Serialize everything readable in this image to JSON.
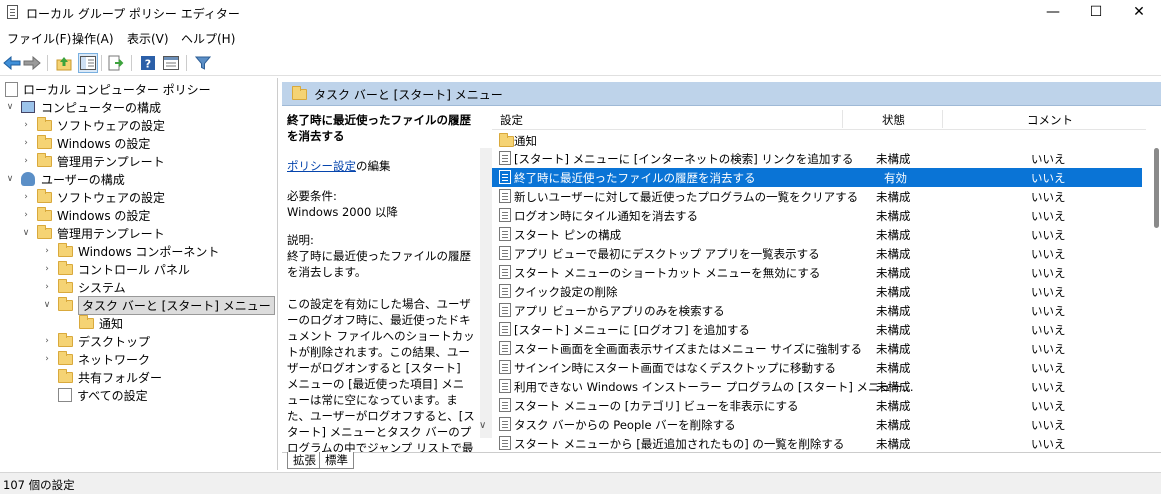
{
  "window": {
    "title": "ローカル グループ ポリシー エディター",
    "controls": {
      "minimize": "—",
      "maximize": "☐",
      "close": "✕"
    }
  },
  "menu": [
    "ファイル(F)",
    "操作(A)",
    "表示(V)",
    "ヘルプ(H)"
  ],
  "toolbar": [
    "back-icon",
    "forward-icon",
    "up-folder-icon",
    "show-tree-icon",
    "export-list-icon",
    "help-icon",
    "properties-icon",
    "filter-icon"
  ],
  "tree": [
    {
      "label": "ローカル コンピューター ポリシー"
    },
    {
      "label": "コンピューターの構成"
    },
    {
      "label": "ソフトウェアの設定"
    },
    {
      "label": "Windows の設定"
    },
    {
      "label": "管理用テンプレート"
    },
    {
      "label": "ユーザーの構成"
    },
    {
      "label": "ソフトウェアの設定"
    },
    {
      "label": "Windows の設定"
    },
    {
      "label": "管理用テンプレート"
    },
    {
      "label": "Windows コンポーネント"
    },
    {
      "label": "コントロール パネル"
    },
    {
      "label": "システム"
    },
    {
      "label": "タスク バーと [スタート] メニュー"
    },
    {
      "label": "通知"
    },
    {
      "label": "デスクトップ"
    },
    {
      "label": "ネットワーク"
    },
    {
      "label": "共有フォルダー"
    },
    {
      "label": "すべての設定"
    }
  ],
  "right_header": {
    "title": "タスク バーと [スタート] メニュー"
  },
  "description": {
    "title": "終了時に最近使ったファイルの履歴を消去する",
    "edit_link": "ポリシー設定",
    "edit_suffix": "の編集",
    "requirement_label": "必要条件:",
    "requirement_value": "Windows 2000 以降",
    "explain_label": "説明:",
    "explain_value": "終了時に最近使ったファイルの履歴を消去します。",
    "detail": "この設定を有効にした場合、ユーザーのログオフ時に、最近使ったドキュメント ファイルへのショートカットが削除されます。この結果、ユーザーがログオンすると [スタート] メニューの [最近使った項目] メニューは常に空になっています。また、ユーザーがログオフすると、[スタート] メニューとタスク バーのプログラムの中でジャンプ リストで最近使った項目や頻繁に使った項目も消去されます。"
  },
  "list": {
    "headers": {
      "setting": "設定",
      "state": "状態",
      "comment": "コメント"
    },
    "folder": "通知",
    "rows": [
      {
        "name": "[スタート] メニューに [インターネットの検索] リンクを追加する",
        "state": "未構成",
        "comment": "いいえ"
      },
      {
        "name": "終了時に最近使ったファイルの履歴を消去する",
        "state": "有効",
        "comment": "いいえ"
      },
      {
        "name": "新しいユーザーに対して最近使ったプログラムの一覧をクリアする",
        "state": "未構成",
        "comment": "いいえ"
      },
      {
        "name": "ログオン時にタイル通知を消去する",
        "state": "未構成",
        "comment": "いいえ"
      },
      {
        "name": "スタート ピンの構成",
        "state": "未構成",
        "comment": "いいえ"
      },
      {
        "name": "アプリ ビューで最初にデスクトップ アプリを一覧表示する",
        "state": "未構成",
        "comment": "いいえ"
      },
      {
        "name": "スタート メニューのショートカット メニューを無効にする",
        "state": "未構成",
        "comment": "いいえ"
      },
      {
        "name": "クイック設定の削除",
        "state": "未構成",
        "comment": "いいえ"
      },
      {
        "name": "アプリ ビューからアプリのみを検索する",
        "state": "未構成",
        "comment": "いいえ"
      },
      {
        "name": "[スタート] メニューに [ログオフ] を追加する",
        "state": "未構成",
        "comment": "いいえ"
      },
      {
        "name": "スタート画面を全画面表示サイズまたはメニュー サイズに強制する",
        "state": "未構成",
        "comment": "いいえ"
      },
      {
        "name": "サインイン時にスタート画面ではなくデスクトップに移動する",
        "state": "未構成",
        "comment": "いいえ"
      },
      {
        "name": "利用できない Windows インストーラー プログラムの [スタート] メニュー...",
        "state": "未構成",
        "comment": "いいえ"
      },
      {
        "name": "スタート メニューの [カテゴリ] ビューを非表示にする",
        "state": "未構成",
        "comment": "いいえ"
      },
      {
        "name": "タスク バーからの People バーを削除する",
        "state": "未構成",
        "comment": "いいえ"
      },
      {
        "name": "スタート メニューから [最近追加されたもの] の一覧を削除する",
        "state": "未構成",
        "comment": "いいえ"
      }
    ]
  },
  "tabs": [
    "拡張",
    "標準"
  ],
  "status": "107 個の設定",
  "colors": {
    "selection": "#0a74d6",
    "header": "#bed3ea",
    "folder": "#f5d374"
  }
}
